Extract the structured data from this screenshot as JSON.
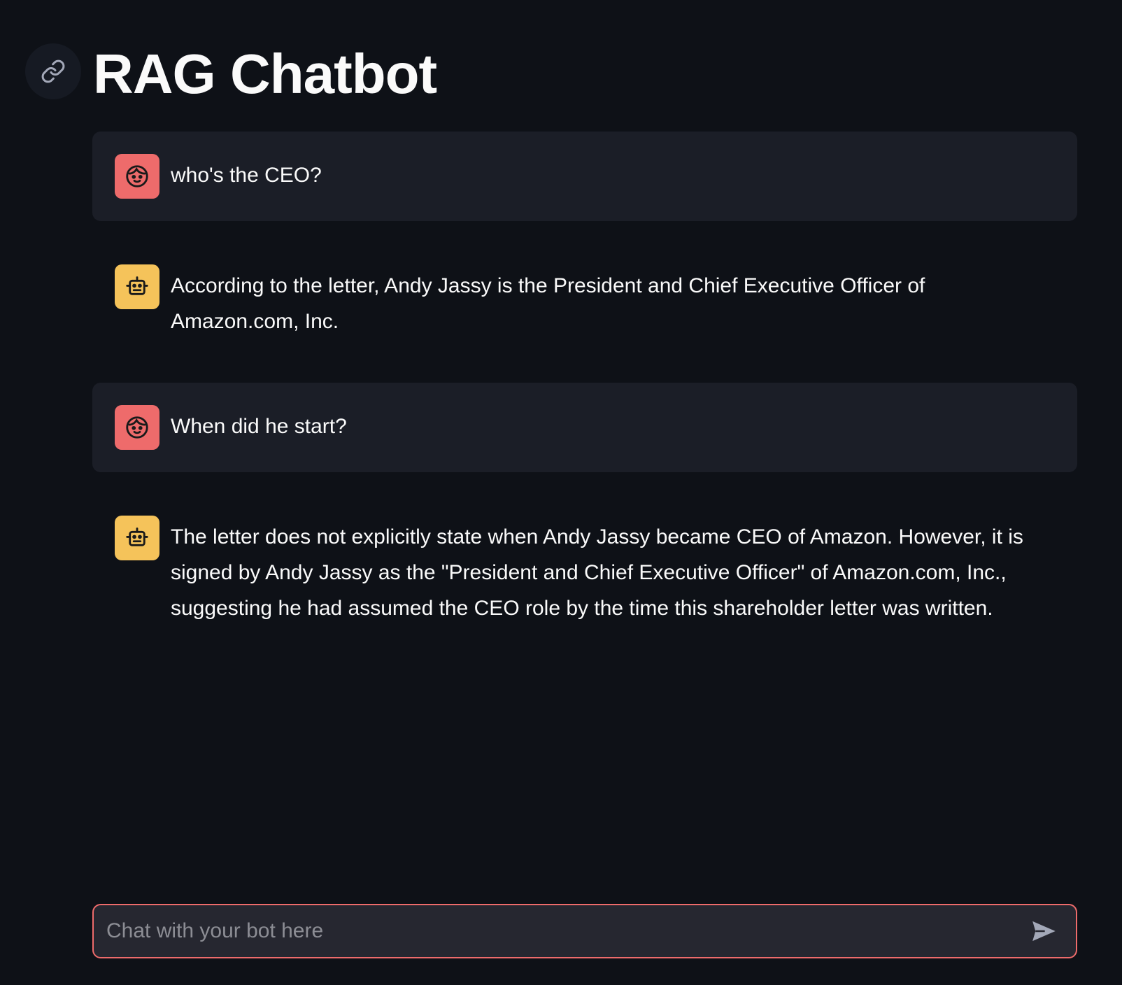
{
  "header": {
    "title": "RAG Chatbot",
    "anchor_icon": "link-icon"
  },
  "messages": [
    {
      "role": "user",
      "avatar_icon": "user-face-icon",
      "text": "who's the CEO?"
    },
    {
      "role": "assistant",
      "avatar_icon": "robot-icon",
      "text": "According to the letter, Andy Jassy is the President and Chief Executive Officer of Amazon.com, Inc."
    },
    {
      "role": "user",
      "avatar_icon": "user-face-icon",
      "text": "When did he start?"
    },
    {
      "role": "assistant",
      "avatar_icon": "robot-icon",
      "text": "The letter does not explicitly state when Andy Jassy became CEO of Amazon. However, it is signed by Andy Jassy as the \"President and Chief Executive Officer\" of Amazon.com, Inc., suggesting he had assumed the CEO role by the time this shareholder letter was written."
    }
  ],
  "chat_input": {
    "placeholder": "Chat with your bot here",
    "value": "",
    "send_icon": "send-icon"
  },
  "colors": {
    "background": "#0e1117",
    "user_message_bg": "#1b1e27",
    "user_avatar": "#ee6b6b",
    "bot_avatar": "#f5c35a",
    "input_border": "#ee6b6b",
    "input_bg": "#262730"
  }
}
